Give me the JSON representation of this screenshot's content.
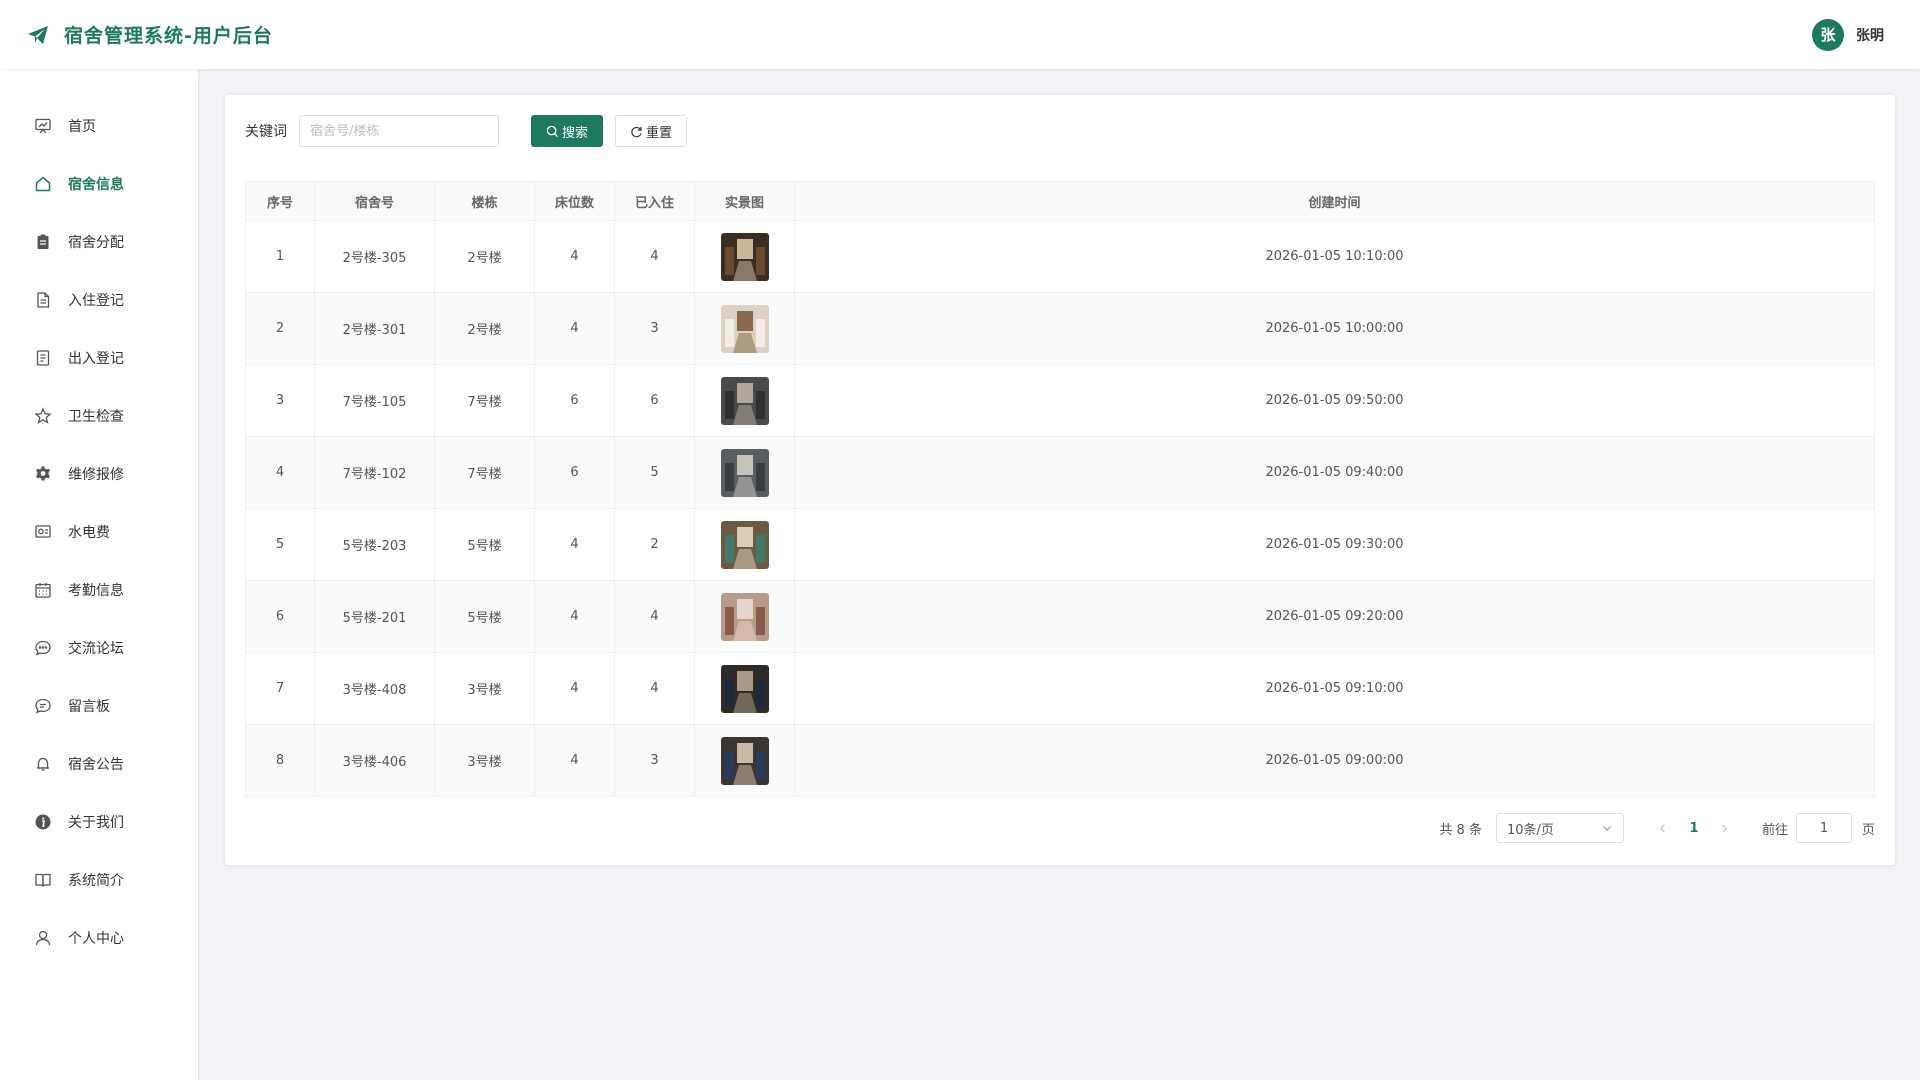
{
  "header": {
    "title": "宿舍管理系统-用户后台",
    "logo_icon": "paper-plane-icon",
    "user": {
      "avatar_text": "张",
      "name": "张明"
    }
  },
  "colors": {
    "primary": "#1e7a5e"
  },
  "sidebar": {
    "items": [
      {
        "label": "首页",
        "icon": "dashboard-icon",
        "active": false
      },
      {
        "label": "宿舍信息",
        "icon": "house-icon",
        "active": true
      },
      {
        "label": "宿舍分配",
        "icon": "clipboard-icon",
        "active": false
      },
      {
        "label": "入住登记",
        "icon": "document-icon",
        "active": false
      },
      {
        "label": "出入登记",
        "icon": "notes-icon",
        "active": false
      },
      {
        "label": "卫生检查",
        "icon": "star-icon",
        "active": false
      },
      {
        "label": "维修报修",
        "icon": "gear-icon",
        "active": false
      },
      {
        "label": "水电费",
        "icon": "wallet-icon",
        "active": false
      },
      {
        "label": "考勤信息",
        "icon": "calendar-icon",
        "active": false
      },
      {
        "label": "交流论坛",
        "icon": "chat-dots-icon",
        "active": false
      },
      {
        "label": "留言板",
        "icon": "chat-lines-icon",
        "active": false
      },
      {
        "label": "宿舍公告",
        "icon": "bell-icon",
        "active": false
      },
      {
        "label": "关于我们",
        "icon": "info-icon",
        "active": false
      },
      {
        "label": "系统简介",
        "icon": "book-icon",
        "active": false
      },
      {
        "label": "个人中心",
        "icon": "user-icon",
        "active": false
      }
    ]
  },
  "search": {
    "label": "关键词",
    "placeholder": "宿舍号/楼栋",
    "value": "",
    "search_button": "搜索",
    "reset_button": "重置"
  },
  "table": {
    "columns": [
      "序号",
      "宿舍号",
      "楼栋",
      "床位数",
      "已入住",
      "实景图",
      "创建时间"
    ],
    "rows": [
      {
        "index": "1",
        "room": "2号楼-305",
        "building": "2号楼",
        "beds": "4",
        "occupied": "4",
        "photo": "room-photo",
        "created": "2026-01-05 10:10:00"
      },
      {
        "index": "2",
        "room": "2号楼-301",
        "building": "2号楼",
        "beds": "4",
        "occupied": "3",
        "photo": "room-photo",
        "created": "2026-01-05 10:00:00"
      },
      {
        "index": "3",
        "room": "7号楼-105",
        "building": "7号楼",
        "beds": "6",
        "occupied": "6",
        "photo": "room-photo",
        "created": "2026-01-05 09:50:00"
      },
      {
        "index": "4",
        "room": "7号楼-102",
        "building": "7号楼",
        "beds": "6",
        "occupied": "5",
        "photo": "room-photo",
        "created": "2026-01-05 09:40:00"
      },
      {
        "index": "5",
        "room": "5号楼-203",
        "building": "5号楼",
        "beds": "4",
        "occupied": "2",
        "photo": "room-photo",
        "created": "2026-01-05 09:30:00"
      },
      {
        "index": "6",
        "room": "5号楼-201",
        "building": "5号楼",
        "beds": "4",
        "occupied": "4",
        "photo": "room-photo",
        "created": "2026-01-05 09:20:00"
      },
      {
        "index": "7",
        "room": "3号楼-408",
        "building": "3号楼",
        "beds": "4",
        "occupied": "4",
        "photo": "room-photo",
        "created": "2026-01-05 09:10:00"
      },
      {
        "index": "8",
        "room": "3号楼-406",
        "building": "3号楼",
        "beds": "4",
        "occupied": "3",
        "photo": "room-photo",
        "created": "2026-01-05 09:00:00"
      }
    ]
  },
  "pagination": {
    "total_text": "共 8 条",
    "page_size": "10条/页",
    "current_page": "1",
    "goto_label": "前往",
    "goto_value": "1",
    "page_suffix": "页"
  }
}
